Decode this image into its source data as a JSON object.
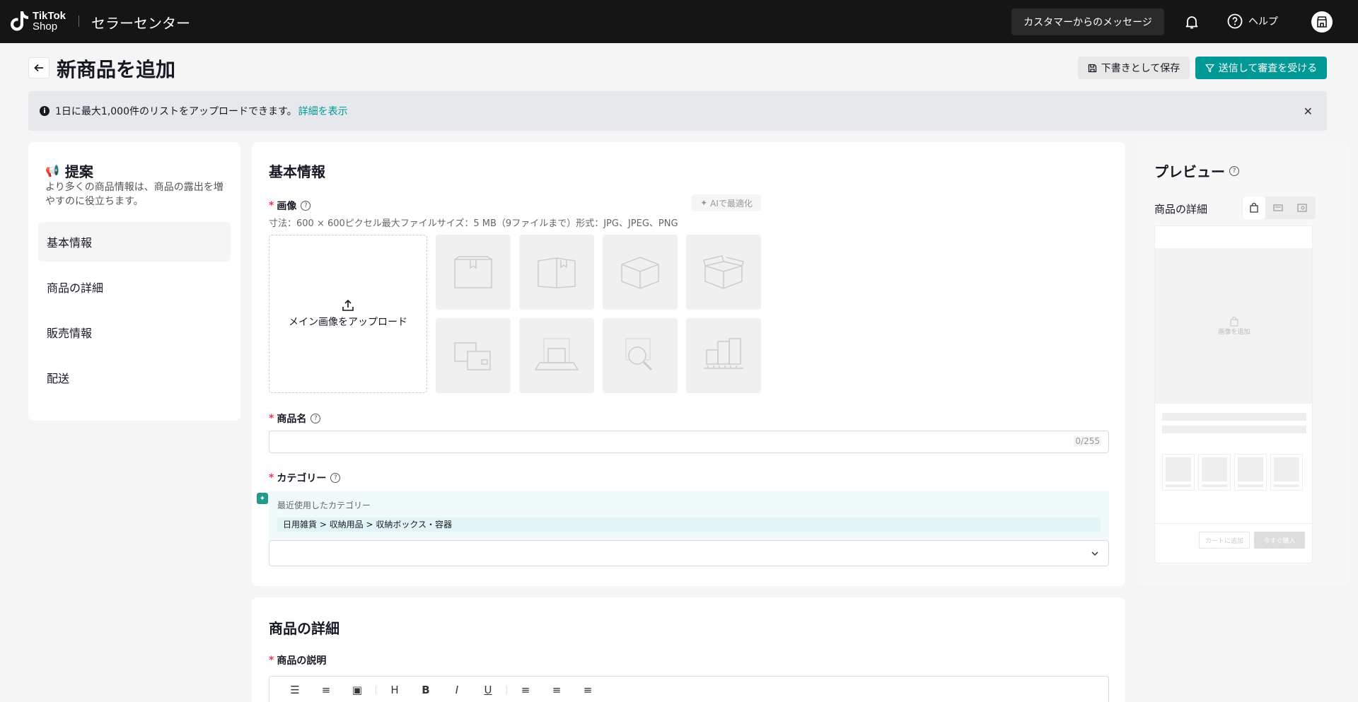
{
  "header": {
    "logo_line1": "TikTok",
    "logo_line2": "Shop",
    "app_title": "セラーセンター",
    "message_button": "カスタマーからのメッセージ",
    "help_label": "ヘルプ"
  },
  "page": {
    "title": "新商品を追加",
    "save_draft": "下書きとして保存",
    "submit": "送信して審査を受ける"
  },
  "notice": {
    "text": "1日に最大1,000件のリストをアップロードできます。",
    "link": "詳細を表示"
  },
  "sidebar": {
    "heading": "提案",
    "description": "より多くの商品情報は、商品の露出を増やすのに役立ちます。",
    "items": [
      {
        "label": "基本情報",
        "active": true
      },
      {
        "label": "商品の詳細",
        "active": false
      },
      {
        "label": "販売情報",
        "active": false
      },
      {
        "label": "配送",
        "active": false
      }
    ]
  },
  "basic_info": {
    "title": "基本情報",
    "image_label": "画像",
    "ai_optimize": "AIで最適化",
    "image_hint": "寸法：600 × 600ピクセル最大ファイルサイズ：5 MB（9ファイルまで）形式：JPG、JPEG、PNG",
    "upload_label": "メイン画像をアップロード",
    "product_name_label": "商品名",
    "product_name_value": "",
    "product_name_counter": "0/255",
    "category_label": "カテゴリー",
    "recent_category_label": "最近使用したカテゴリー",
    "recent_category_path": "日用雑貨 > 収納用品 > 収納ボックス・容器",
    "category_value": ""
  },
  "product_details": {
    "title": "商品の詳細",
    "description_label": "商品の説明"
  },
  "preview": {
    "title": "プレビュー",
    "subtitle": "商品の詳細",
    "add_image": "画像を追加",
    "add_to_cart": "カートに追加",
    "buy_now": "今すぐ購入"
  },
  "colors": {
    "accent": "#009995",
    "topbar": "#151515",
    "required": "#fe2c55"
  }
}
